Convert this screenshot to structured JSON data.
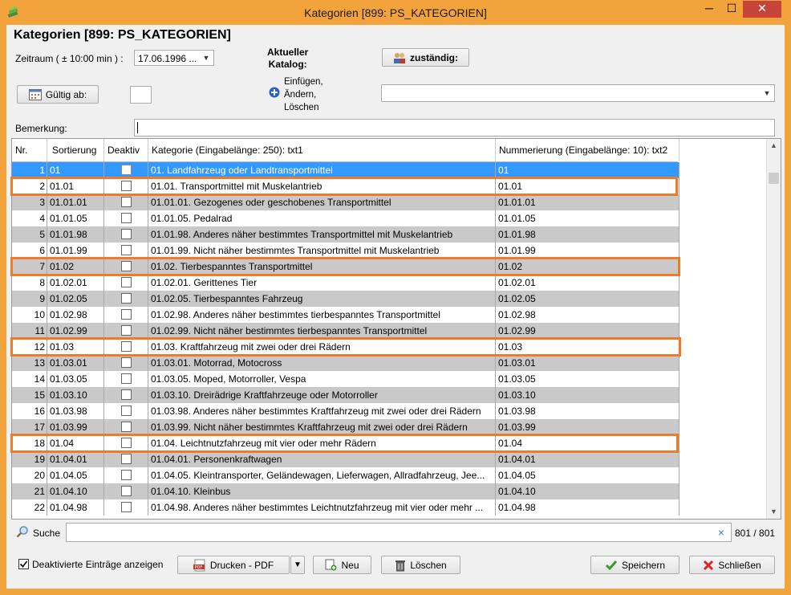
{
  "window": {
    "title": "Kategorien [899: PS_KATEGORIEN]",
    "minimize": "─",
    "maximize": "☐",
    "close": "✕"
  },
  "form": {
    "heading": "Kategorien [899: PS_KATEGORIEN]",
    "zeitraum_label": "Zeitraum ( ± 10:00 min ) :",
    "zeitraum_value": "17.06.1996 ...",
    "aktueller_katalog_label": "Aktueller\nKatalog:",
    "zustaendig_label": "zuständig:",
    "gueltig_label": "Gültig ab:",
    "gueltig_value": "",
    "einfuegen_label": "Einfügen,\nÄndern,\nLöschen",
    "katalog_combo_value": "",
    "bemerkung_label": "Bemerkung:",
    "bemerkung_value": ""
  },
  "table": {
    "columns": [
      "Nr.",
      "Sortierung",
      "Deaktiv",
      "Kategorie (Eingabelänge: 250): txt1",
      "Nummerierung (Eingabelänge: 10): txt2"
    ],
    "rows": [
      {
        "nr": "1",
        "sort": "01",
        "kat": "01. Landfahrzeug oder Landtransportmittel",
        "num": "01"
      },
      {
        "nr": "2",
        "sort": "01.01",
        "kat": "01.01. Transportmittel mit Muskelantrieb",
        "num": "01.01"
      },
      {
        "nr": "3",
        "sort": "01.01.01",
        "kat": "01.01.01. Gezogenes oder geschobenes Transportmittel",
        "num": "01.01.01"
      },
      {
        "nr": "4",
        "sort": "01.01.05",
        "kat": "01.01.05. Pedalrad",
        "num": "01.01.05"
      },
      {
        "nr": "5",
        "sort": "01.01.98",
        "kat": "01.01.98. Anderes näher bestimmtes Transportmittel mit Muskelantrieb",
        "num": "01.01.98"
      },
      {
        "nr": "6",
        "sort": "01.01.99",
        "kat": "01.01.99. Nicht näher bestimmtes Transportmittel mit Muskelantrieb",
        "num": "01.01.99"
      },
      {
        "nr": "7",
        "sort": "01.02",
        "kat": "01.02. Tierbespanntes Transportmittel",
        "num": "01.02"
      },
      {
        "nr": "8",
        "sort": "01.02.01",
        "kat": "01.02.01. Gerittenes Tier",
        "num": "01.02.01"
      },
      {
        "nr": "9",
        "sort": "01.02.05",
        "kat": "01.02.05. Tierbespanntes Fahrzeug",
        "num": "01.02.05"
      },
      {
        "nr": "10",
        "sort": "01.02.98",
        "kat": "01.02.98. Anderes näher bestimmtes tierbespanntes Transportmittel",
        "num": "01.02.98"
      },
      {
        "nr": "11",
        "sort": "01.02.99",
        "kat": "01.02.99. Nicht näher bestimmtes tierbespanntes Transportmittel",
        "num": "01.02.99"
      },
      {
        "nr": "12",
        "sort": "01.03",
        "kat": "01.03. Kraftfahrzeug mit zwei oder drei Rädern",
        "num": "01.03"
      },
      {
        "nr": "13",
        "sort": "01.03.01",
        "kat": "01.03.01. Motorrad, Motocross",
        "num": "01.03.01"
      },
      {
        "nr": "14",
        "sort": "01.03.05",
        "kat": "01.03.05. Moped, Motorroller, Vespa",
        "num": "01.03.05"
      },
      {
        "nr": "15",
        "sort": "01.03.10",
        "kat": "01.03.10. Dreirädrige Kraftfahrzeuge oder Motorroller",
        "num": "01.03.10"
      },
      {
        "nr": "16",
        "sort": "01.03.98",
        "kat": "01.03.98. Anderes näher bestimmtes Kraftfahrzeug mit zwei oder drei Rädern",
        "num": "01.03.98"
      },
      {
        "nr": "17",
        "sort": "01.03.99",
        "kat": "01.03.99. Nicht näher bestimmtes Kraftfahrzeug mit zwei oder drei Rädern",
        "num": "01.03.99"
      },
      {
        "nr": "18",
        "sort": "01.04",
        "kat": "01.04. Leichtnutzfahrzeug mit vier oder mehr Rädern",
        "num": "01.04"
      },
      {
        "nr": "19",
        "sort": "01.04.01",
        "kat": "01.04.01. Personenkraftwagen",
        "num": "01.04.01"
      },
      {
        "nr": "20",
        "sort": "01.04.05",
        "kat": "01.04.05. Kleintransporter, Geländewagen, Lieferwagen, Allradfahrzeug, Jee...",
        "num": "01.04.05"
      },
      {
        "nr": "21",
        "sort": "01.04.10",
        "kat": "01.04.10. Kleinbus",
        "num": "01.04.10"
      },
      {
        "nr": "22",
        "sort": "01.04.98",
        "kat": "01.04.98. Anderes näher bestimmtes Leichtnutzfahrzeug mit vier oder mehr ...",
        "num": "01.04.98"
      }
    ]
  },
  "search": {
    "label": "Suche",
    "value": "",
    "clear": "×",
    "count": "801 / 801"
  },
  "footer": {
    "deaktivierte_label": "Deaktivierte Einträge anzeigen",
    "deaktivierte_checked": true,
    "drucken_label": "Drucken - PDF",
    "neu_label": "Neu",
    "loeschen_label": "Löschen",
    "speichern_label": "Speichern",
    "schliessen_label": "Schließen"
  },
  "colors": {
    "title_bar": "#f3a33b",
    "highlight": "#ee7a2c",
    "selected_row": "#3399ff",
    "gray_row": "#c9c9c9"
  }
}
